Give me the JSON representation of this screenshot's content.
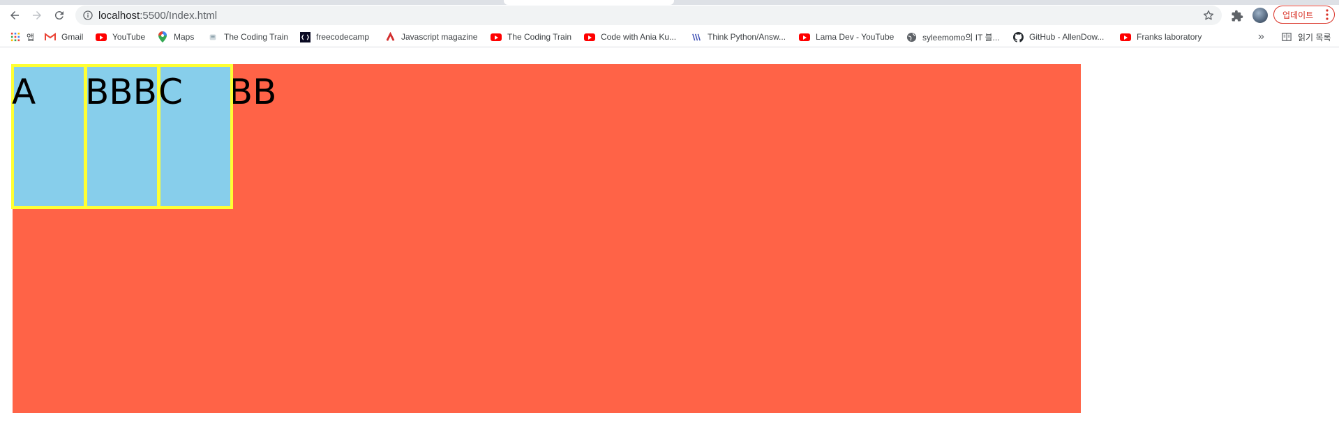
{
  "browser": {
    "url_host": "localhost",
    "url_path": ":5500/Index.html",
    "update_label": "업데이트",
    "bookmarks": [
      {
        "label": "앱",
        "icon": "apps-grid-icon"
      },
      {
        "label": "Gmail",
        "icon": "gmail-icon"
      },
      {
        "label": "YouTube",
        "icon": "youtube-icon"
      },
      {
        "label": "Maps",
        "icon": "maps-pin-icon"
      },
      {
        "label": "The Coding Train",
        "icon": "coding-train-icon"
      },
      {
        "label": "freecodecamp",
        "icon": "freecodecamp-icon"
      },
      {
        "label": "Javascript magazine",
        "icon": "js-magazine-icon"
      },
      {
        "label": "The Coding Train",
        "icon": "youtube-icon"
      },
      {
        "label": "Code with Ania Ku...",
        "icon": "youtube-icon"
      },
      {
        "label": "Think Python/Answ...",
        "icon": "think-python-icon"
      },
      {
        "label": "Lama Dev - YouTube",
        "icon": "youtube-icon"
      },
      {
        "label": "syleemomo의 IT 블...",
        "icon": "globe-icon"
      },
      {
        "label": "GitHub - AllenDow...",
        "icon": "github-icon"
      },
      {
        "label": "Franks laboratory",
        "icon": "youtube-icon"
      }
    ],
    "overflow_label": "»",
    "reading_list_label": "읽기 목록"
  },
  "page": {
    "container_color": "#ff6347",
    "box_color": "#87ceeb",
    "box_border_color": "#ffff33",
    "boxes": [
      {
        "text": "A"
      },
      {
        "text": "BBBBBBBB"
      },
      {
        "text": "C"
      }
    ]
  }
}
